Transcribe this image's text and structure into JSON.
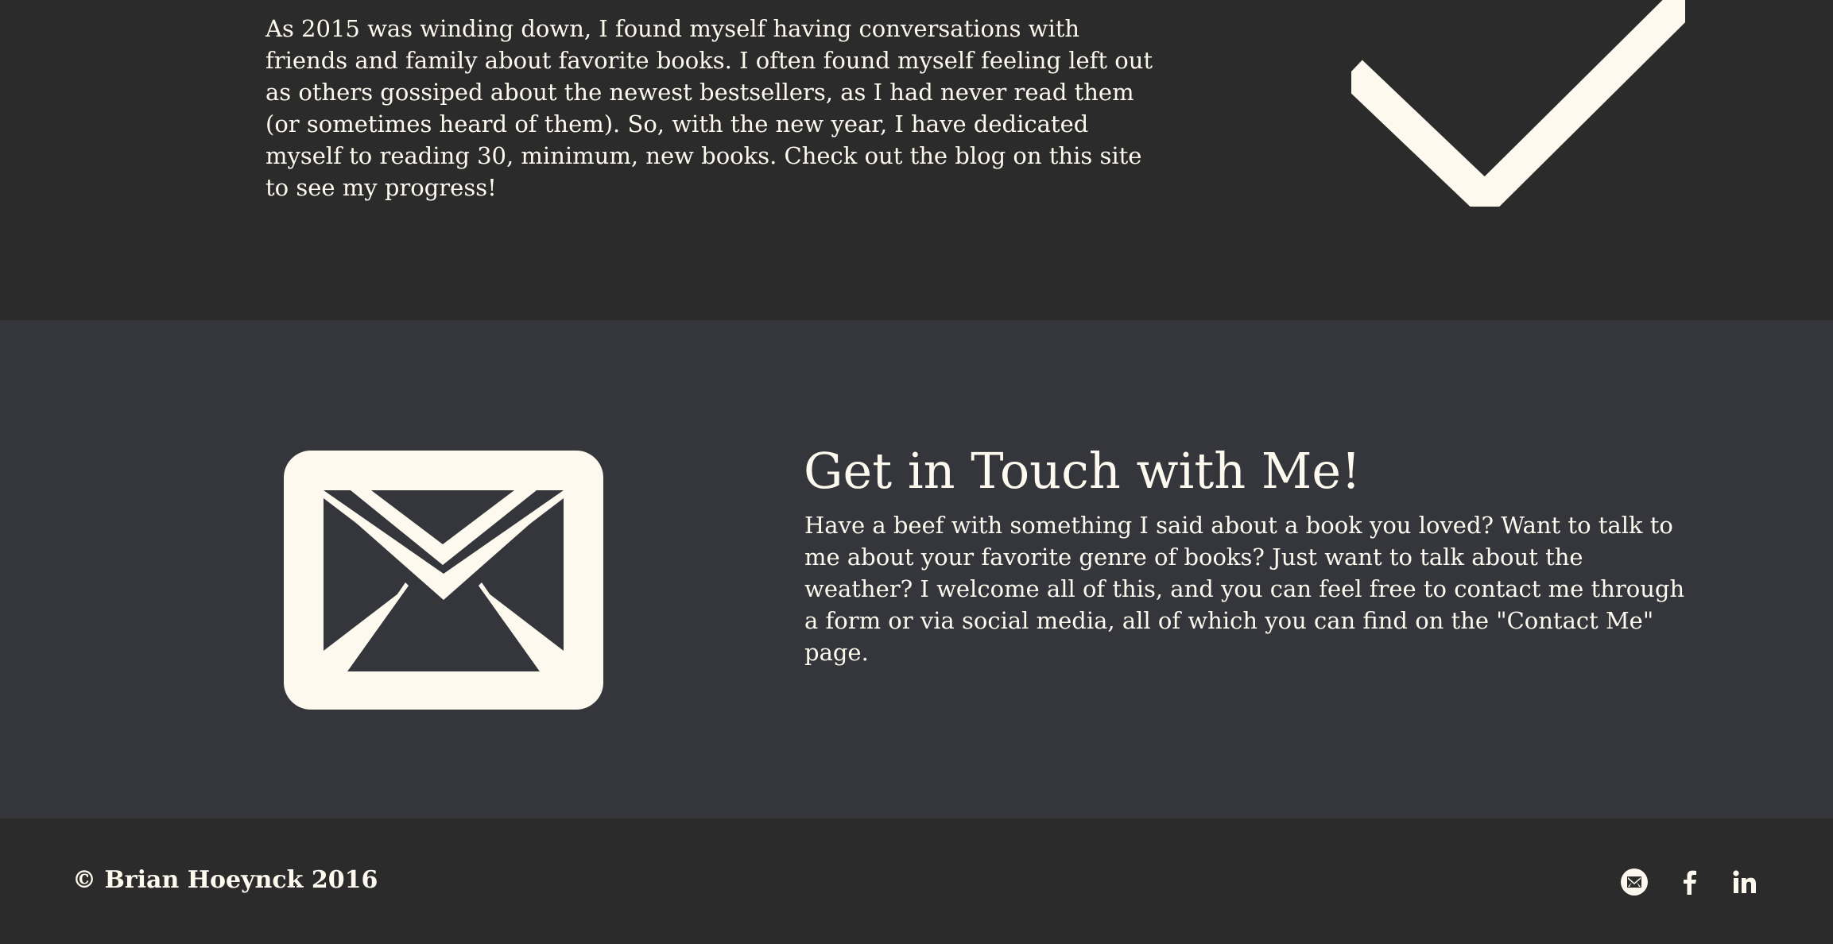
{
  "intro": {
    "paragraph": "As 2015 was winding down, I found myself having conversations with friends and family about favorite books. I often found myself feeling left out as others gossiped about the newest bestsellers, as I had never read them (or sometimes heard of them). So, with the new year, I have dedicated myself to reading 30, minimum, new books. Check out the blog on this site to see my progress!",
    "icon": "checkmark-icon"
  },
  "contact": {
    "heading": "Get in Touch with Me!",
    "paragraph": "Have a beef with something I said about a book you loved? Want to talk to me about your favorite genre of books? Just want to talk about the weather? I welcome all of this, and you can feel free to contact me through a form or via social media, all of which you can find on the \"Contact Me\" page.",
    "icon": "envelope-icon"
  },
  "footer": {
    "copyright": "© Brian Hoeynck 2016",
    "social": [
      "email-icon",
      "facebook-icon",
      "linkedin-icon"
    ]
  },
  "colors": {
    "dark_bg": "#2b2b2b",
    "contact_bg": "#34363b",
    "text": "#fdf9ef"
  }
}
